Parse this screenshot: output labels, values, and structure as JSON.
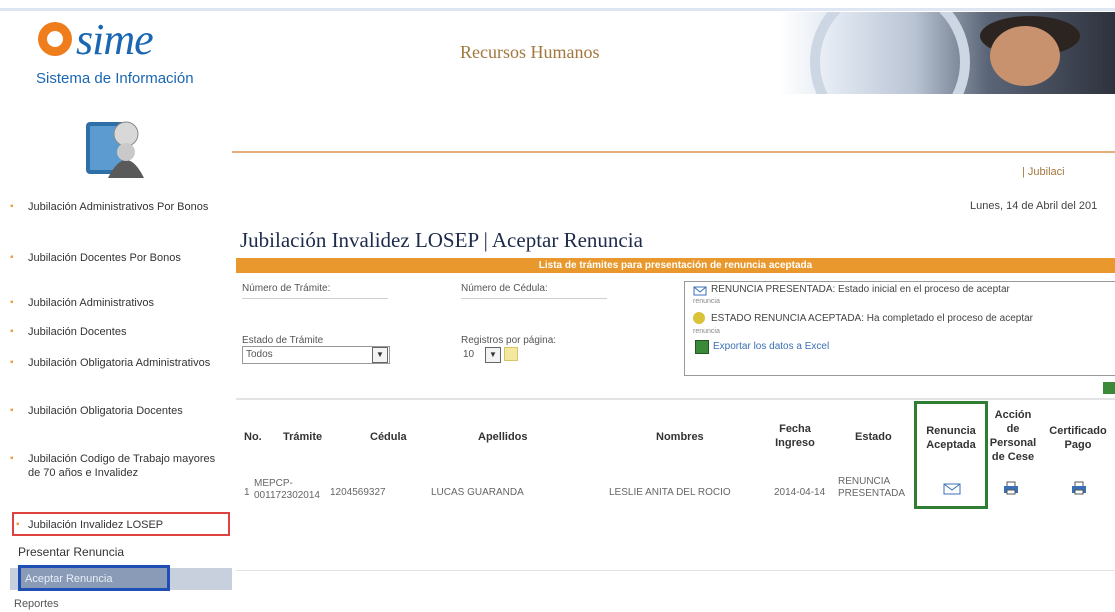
{
  "header": {
    "logo_text": "sime",
    "logo_subtitle": "Sistema de Información",
    "section_title": "Recursos Humanos",
    "jubilacion_link": "| Jubilaci",
    "date": "Lunes, 14 de Abril del 201"
  },
  "sidebar": {
    "items": [
      {
        "label": "Jubilación Administrativos Por Bonos"
      },
      {
        "label": "Jubilación Docentes Por Bonos"
      },
      {
        "label": "Jubilación Administrativos"
      },
      {
        "label": "Jubilación Docentes"
      },
      {
        "label": "Jubilación Obligatoria Administrativos"
      },
      {
        "label": "Jubilación Obligatoria Docentes"
      },
      {
        "label": "Jubilación Codigo de Trabajo mayores de 70 años e Invalidez"
      },
      {
        "label": "Jubilación Invalidez LOSEP"
      }
    ],
    "sub_items": {
      "presentar": "Presentar Renuncia",
      "aceptar": "Aceptar Renuncia",
      "reportes": "Reportes"
    }
  },
  "main": {
    "title": "Jubilación Invalidez LOSEP | Aceptar Renuncia",
    "bar_title": "Lista de trámites para presentación de renuncia aceptada",
    "filters": {
      "numero_tramite_label": "Número de Trámite:",
      "numero_cedula_label": "Número de Cédula:",
      "estado_tramite_label": "Estado de Trámite",
      "estado_tramite_value": "Todos",
      "registros_label": "Registros por página:",
      "registros_value": "10"
    },
    "legend": {
      "presentada": "RENUNCIA PRESENTADA: Estado inicial en el proceso de aceptar",
      "tiny1": "renuncia",
      "aceptada": "ESTADO RENUNCIA ACEPTADA: Ha completado el proceso de aceptar",
      "tiny2": "renuncia",
      "exportar": "Exportar los datos a Excel"
    },
    "table": {
      "headers": {
        "no": "No.",
        "tramite": "Trámite",
        "cedula": "Cédula",
        "apellidos": "Apellidos",
        "nombres": "Nombres",
        "fecha": "Fecha Ingreso",
        "estado": "Estado",
        "renuncia": "Renuncia Aceptada",
        "accion": "Acción de Personal de Cese",
        "certificado": "Certificado Pago"
      },
      "rows": [
        {
          "no": "1",
          "tramite": "MEPCP-001172302014",
          "cedula": "1204569327",
          "apellidos": "LUCAS GUARANDA",
          "nombres": "LESLIE ANITA DEL ROCIO",
          "fecha": "2014-04-14",
          "estado": "RENUNCIA PRESENTADA"
        }
      ]
    }
  }
}
